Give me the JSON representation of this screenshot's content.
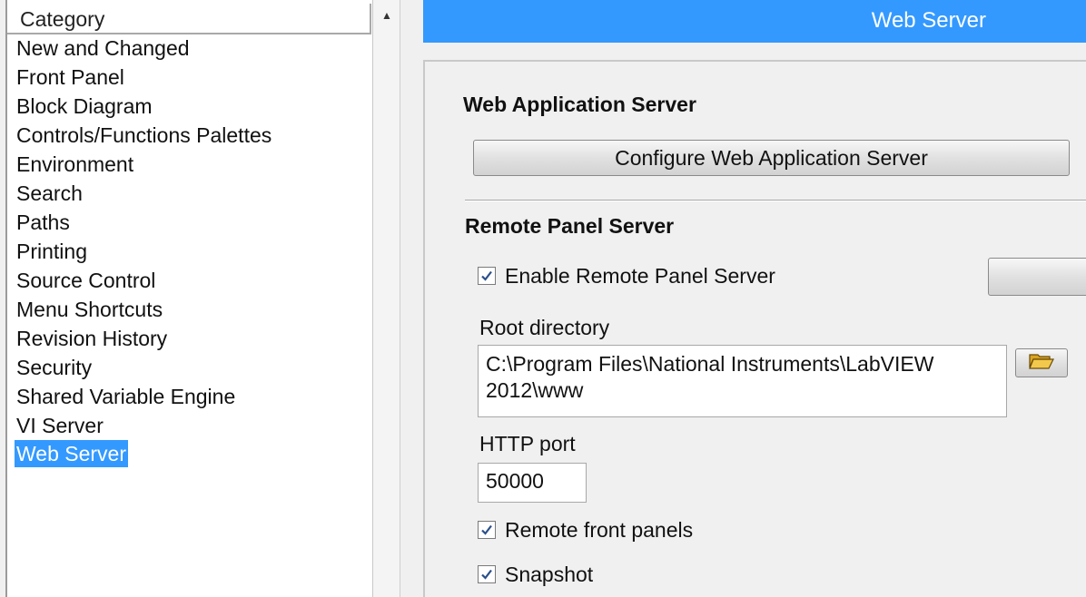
{
  "category_list": {
    "header": "Category",
    "items": [
      "New and Changed",
      "Front Panel",
      "Block Diagram",
      "Controls/Functions Palettes",
      "Environment",
      "Search",
      "Paths",
      "Printing",
      "Source Control",
      "Menu Shortcuts",
      "Revision History",
      "Security",
      "Shared Variable Engine",
      "VI Server",
      "Web Server"
    ],
    "selected": "Web Server"
  },
  "panel": {
    "title": "Web Server",
    "accent_color": "#3399ff"
  },
  "web_app_server": {
    "heading": "Web Application Server",
    "configure_label": "Configure Web Application Server"
  },
  "remote_panel": {
    "heading": "Remote Panel Server",
    "enable_label": "Enable Remote Panel Server",
    "enable_checked": true,
    "root_dir_label": "Root directory",
    "root_dir_line1": "C:\\Program Files\\National Instruments\\LabVIEW",
    "root_dir_line2": "2012\\www",
    "folder_icon": "folder-open-icon",
    "http_port_label": "HTTP port",
    "http_port_value": "50000",
    "remote_front_panels_label": "Remote front panels",
    "remote_front_panels_checked": true,
    "snapshot_label": "Snapshot",
    "snapshot_checked": true
  }
}
